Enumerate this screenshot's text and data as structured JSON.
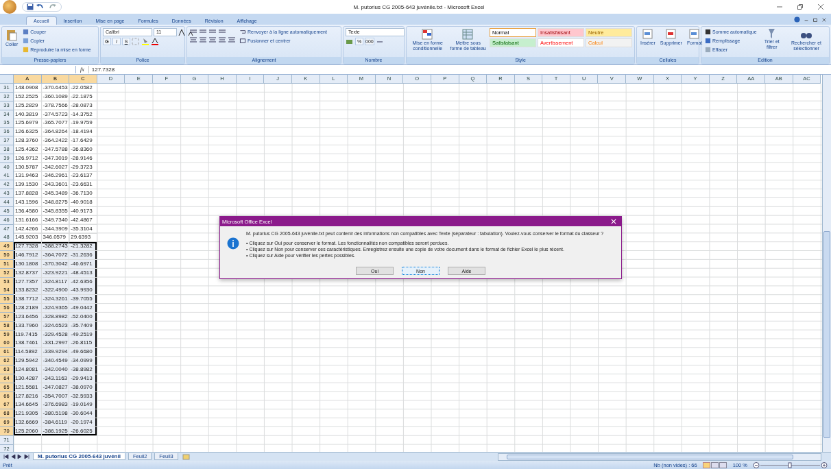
{
  "window": {
    "title": "M. putorius CG 2005-643 juvénile.txt - Microsoft Excel"
  },
  "tabs": [
    {
      "label": "Accueil",
      "selected": true
    },
    {
      "label": "Insertion",
      "selected": false
    },
    {
      "label": "Mise en page",
      "selected": false
    },
    {
      "label": "Formules",
      "selected": false
    },
    {
      "label": "Données",
      "selected": false
    },
    {
      "label": "Révision",
      "selected": false
    },
    {
      "label": "Affichage",
      "selected": false
    }
  ],
  "clipboard": {
    "label": "Presse-papiers",
    "paste": "Coller",
    "items": [
      "Couper",
      "Copier",
      "Reproduire la mise en forme"
    ]
  },
  "font": {
    "label": "Police",
    "family": "Calibri",
    "size": "11",
    "styles": [
      "G",
      "I",
      "S"
    ]
  },
  "alignment": {
    "label": "Alignement",
    "wrap": "Renvoyer à la ligne automatiquement",
    "merge": "Fusionner et centrer"
  },
  "number": {
    "label": "Nombre",
    "format": "Texte",
    "buttons": [
      "%",
      "000"
    ]
  },
  "style": {
    "label": "Style",
    "conditional": "Mise en forme conditionnelle",
    "table": "Mettre sous forme de tableau",
    "cell_styles": [
      {
        "label": "Normal",
        "kind": "normal",
        "color": "#ffffff",
        "selected": true
      },
      {
        "label": "Insatisfaisant",
        "kind": "bad",
        "color": "#ffc7ce",
        "selected": false
      },
      {
        "label": "Neutre",
        "kind": "neutral",
        "color": "#ffeb9c",
        "selected": false
      },
      {
        "label": "Satisfaisant",
        "kind": "good",
        "color": "#c6efce",
        "selected": false
      },
      {
        "label": "Avertissement",
        "kind": "warning",
        "color": "#ffffff",
        "selected": false
      },
      {
        "label": "Calcul",
        "kind": "calc",
        "color": "#f2f2f2",
        "selected": false
      }
    ]
  },
  "cells_group": {
    "label": "Cellules",
    "buttons": [
      "Insérer",
      "Supprimer",
      "Format"
    ]
  },
  "editing": {
    "label": "Edition",
    "items": [
      "Somme automatique",
      "Remplissage",
      "Effacer"
    ],
    "sort": "Trier et filtrer",
    "find": "Rechercher et sélectionner"
  },
  "formula_bar": {
    "fx": "fx",
    "value": "127.7328"
  },
  "sheet": {
    "columns": [
      {
        "label": "A",
        "selected": true
      },
      {
        "label": "B",
        "selected": true
      },
      {
        "label": "C",
        "selected": true
      },
      {
        "label": "D",
        "selected": false
      },
      {
        "label": "E",
        "selected": false
      },
      {
        "label": "F",
        "selected": false
      },
      {
        "label": "G",
        "selected": false
      },
      {
        "label": "H",
        "selected": false
      },
      {
        "label": "I",
        "selected": false
      },
      {
        "label": "J",
        "selected": false
      },
      {
        "label": "K",
        "selected": false
      },
      {
        "label": "L",
        "selected": false
      },
      {
        "label": "M",
        "selected": false
      },
      {
        "label": "N",
        "selected": false
      },
      {
        "label": "O",
        "selected": false
      },
      {
        "label": "P",
        "selected": false
      },
      {
        "label": "Q",
        "selected": false
      },
      {
        "label": "R",
        "selected": false
      },
      {
        "label": "S",
        "selected": false
      },
      {
        "label": "T",
        "selected": false
      },
      {
        "label": "U",
        "selected": false
      },
      {
        "label": "V",
        "selected": false
      },
      {
        "label": "W",
        "selected": false
      },
      {
        "label": "X",
        "selected": false
      },
      {
        "label": "Y",
        "selected": false
      },
      {
        "label": "Z",
        "selected": false
      },
      {
        "label": "AA",
        "selected": false
      },
      {
        "label": "AB",
        "selected": false
      },
      {
        "label": "AC",
        "selected": false
      }
    ],
    "rows": [
      {
        "num": "31",
        "cells": [
          "148.0908",
          "-370.6453",
          "-22.0582"
        ],
        "selected": false
      },
      {
        "num": "32",
        "cells": [
          "152.2525",
          "-360.1089",
          "-22.1875"
        ],
        "selected": false
      },
      {
        "num": "33",
        "cells": [
          "125.2829",
          "-378.7566",
          "-28.0873"
        ],
        "selected": false
      },
      {
        "num": "34",
        "cells": [
          "140.3819",
          "-374.5723",
          "-14.3752"
        ],
        "selected": false
      },
      {
        "num": "35",
        "cells": [
          "125.6979",
          "-365.7077",
          "-19.9759"
        ],
        "selected": false
      },
      {
        "num": "36",
        "cells": [
          "126.6325",
          "-364.8264",
          "-18.4194"
        ],
        "selected": false
      },
      {
        "num": "37",
        "cells": [
          "128.3760",
          "-364.2422",
          "-17.6429"
        ],
        "selected": false
      },
      {
        "num": "38",
        "cells": [
          "125.4362",
          "-347.5788",
          "-36.8360"
        ],
        "selected": false
      },
      {
        "num": "39",
        "cells": [
          "126.9712",
          "-347.3019",
          "-28.9146"
        ],
        "selected": false
      },
      {
        "num": "40",
        "cells": [
          "130.5787",
          "-342.6027",
          "-29.3723"
        ],
        "selected": false
      },
      {
        "num": "41",
        "cells": [
          "131.9463",
          "-346.2961",
          "-23.6137"
        ],
        "selected": false
      },
      {
        "num": "42",
        "cells": [
          "139.1530",
          "-343.3601",
          "-23.6631"
        ],
        "selected": false
      },
      {
        "num": "43",
        "cells": [
          "137.8828",
          "-345.3489",
          "-36.7130"
        ],
        "selected": false
      },
      {
        "num": "44",
        "cells": [
          "143.1596",
          "-348.8275",
          "-40.9018"
        ],
        "selected": false
      },
      {
        "num": "45",
        "cells": [
          "136.4580",
          "-345.8355",
          "-40.9173"
        ],
        "selected": false
      },
      {
        "num": "46",
        "cells": [
          "131.6166",
          "-349.7340",
          "-42.4867"
        ],
        "selected": false
      },
      {
        "num": "47",
        "cells": [
          "142.4266",
          "-344.3909",
          "-35.3104"
        ],
        "selected": false
      },
      {
        "num": "48",
        "cells": [
          "145.9203",
          "346.0579",
          "29.6393"
        ],
        "selected": false
      },
      {
        "num": "49",
        "cells": [
          "127.7328",
          "-388.2743",
          "-21.3282"
        ],
        "selected": true
      },
      {
        "num": "50",
        "cells": [
          "146.7912",
          "-364.7072",
          "-31.2636"
        ],
        "selected": true
      },
      {
        "num": "51",
        "cells": [
          "130.1808",
          "-370.3042",
          "-46.6971"
        ],
        "selected": true
      },
      {
        "num": "52",
        "cells": [
          "132.8737",
          "-323.9221",
          "-48.4513"
        ],
        "selected": true
      },
      {
        "num": "53",
        "cells": [
          "127.7357",
          "-324.8117",
          "-42.6356"
        ],
        "selected": true
      },
      {
        "num": "54",
        "cells": [
          "133.8232",
          "-322.4900",
          "-43.9930"
        ],
        "selected": true
      },
      {
        "num": "55",
        "cells": [
          "138.7712",
          "-324.3261",
          "-39.7055"
        ],
        "selected": true
      },
      {
        "num": "56",
        "cells": [
          "128.2189",
          "-324.9365",
          "-49.0442"
        ],
        "selected": true
      },
      {
        "num": "57",
        "cells": [
          "123.6456",
          "-328.8982",
          "-52.0400"
        ],
        "selected": true
      },
      {
        "num": "58",
        "cells": [
          "133.7960",
          "-324.6523",
          "-35.7409"
        ],
        "selected": true
      },
      {
        "num": "59",
        "cells": [
          "119.7415",
          "-329.4528",
          "-49.2519"
        ],
        "selected": true
      },
      {
        "num": "60",
        "cells": [
          "138.7461",
          "-331.2997",
          "-26.8115"
        ],
        "selected": true
      },
      {
        "num": "61",
        "cells": [
          "114.5892",
          "-339.9294",
          "-49.6680"
        ],
        "selected": true
      },
      {
        "num": "62",
        "cells": [
          "129.5942",
          "-340.4549",
          "-34.0999"
        ],
        "selected": true
      },
      {
        "num": "63",
        "cells": [
          "124.8081",
          "-342.0040",
          "-38.8982"
        ],
        "selected": true
      },
      {
        "num": "64",
        "cells": [
          "130.4287",
          "-343.1163",
          "-29.9413"
        ],
        "selected": true
      },
      {
        "num": "65",
        "cells": [
          "121.5581",
          "-347.0827",
          "-38.0970"
        ],
        "selected": true
      },
      {
        "num": "66",
        "cells": [
          "127.8216",
          "-354.7007",
          "-32.5933"
        ],
        "selected": true
      },
      {
        "num": "67",
        "cells": [
          "134.6645",
          "-376.6983",
          "-19.0149"
        ],
        "selected": true
      },
      {
        "num": "68",
        "cells": [
          "121.9305",
          "-380.5198",
          "-30.6044"
        ],
        "selected": true
      },
      {
        "num": "69",
        "cells": [
          "132.6669",
          "-384.6119",
          "-20.1974"
        ],
        "selected": true
      },
      {
        "num": "70",
        "cells": [
          "125.2060",
          "-386.1925",
          "-26.6025"
        ],
        "selected": true
      },
      {
        "num": "71",
        "cells": [],
        "selected": false
      },
      {
        "num": "72",
        "cells": [],
        "selected": false
      }
    ]
  },
  "sheet_tabs": [
    {
      "label": "M. putorius CG 2005-643 juvénil",
      "selected": true
    },
    {
      "label": "Feuil2",
      "selected": false
    },
    {
      "label": "Feuil3",
      "selected": false
    }
  ],
  "status_bar": {
    "state": "Prêt",
    "count": "Nb (non vides) : 66",
    "zoom": "100 %"
  },
  "dialog": {
    "title": "Microsoft Office Excel",
    "message": "M. putorius CG 2005-643 juvénile.txt peut contenir des informations non compatibles avec Texte (séparateur : tabulation). Voulez-vous conserver le format du classeur ?",
    "bullets": [
      "• Cliquez sur Oui pour conserver le format. Les fonctionnalités non compatibles seront perdues.",
      "• Cliquez sur Non pour conserver ces caractéristiques. Enregistrez ensuite une copie de votre document dans le format de fichier Excel le plus récent.",
      "• Cliquez sur Aide pour vérifier les pertes possibles."
    ],
    "buttons": [
      {
        "label": "Oui",
        "selected": false
      },
      {
        "label": "Non",
        "selected": true
      },
      {
        "label": "Aide",
        "selected": false
      }
    ]
  }
}
